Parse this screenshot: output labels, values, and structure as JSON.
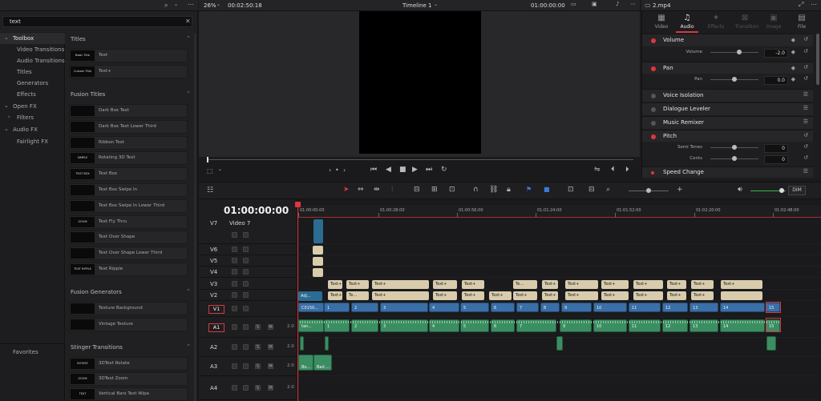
{
  "search": {
    "query": "text"
  },
  "tree": {
    "items": [
      {
        "label": "Toolbox",
        "arrow": "⌄"
      },
      {
        "label": "Video Transitions"
      },
      {
        "label": "Audio Transitions"
      },
      {
        "label": "Titles"
      },
      {
        "label": "Generators"
      },
      {
        "label": "Effects"
      },
      {
        "label": "Open FX",
        "arrow": "⌄"
      },
      {
        "label": "Filters",
        "arrow": "›"
      },
      {
        "label": "Audio FX",
        "arrow": "⌄"
      },
      {
        "label": "Fairlight FX"
      }
    ],
    "favorites": "Favorites"
  },
  "sections": {
    "titles": "Titles",
    "fusion_titles": "Fusion Titles",
    "fusion_generators": "Fusion Generators",
    "stinger": "Stinger Transitions"
  },
  "titles_items": [
    {
      "thumb": "Basic Title",
      "label": "Text"
    },
    {
      "thumb": "Custom Title",
      "label": "Text+"
    }
  ],
  "fusion_titles_items": [
    {
      "thumb": "",
      "label": "Dark Box Text"
    },
    {
      "thumb": "",
      "label": "Dark Box Text Lower Third"
    },
    {
      "thumb": "",
      "label": "Ribbon Text"
    },
    {
      "thumb": "SIMPLE",
      "label": "Rotating 3D Text"
    },
    {
      "thumb": "TEXT BOX",
      "label": "Text Box"
    },
    {
      "thumb": "",
      "label": "Text Box Swipe In"
    },
    {
      "thumb": "",
      "label": "Text Box Swipe In Lower Third"
    },
    {
      "thumb": "ZOOM",
      "label": "Text Fly Thru"
    },
    {
      "thumb": "",
      "label": "Text Over Shape"
    },
    {
      "thumb": "",
      "label": "Text Over Shape Lower Third"
    },
    {
      "thumb": "TEXT RIPPLE",
      "label": "Text Ripple"
    }
  ],
  "fusion_generators_items": [
    {
      "thumb": "",
      "label": "Texture Background"
    },
    {
      "thumb": "",
      "label": "Vintage Texture"
    }
  ],
  "stinger_items": [
    {
      "thumb": "ROTATE",
      "label": "3DText Rotate"
    },
    {
      "thumb": "ZOOM",
      "label": "3DText Zoom"
    },
    {
      "thumb": "TEXT",
      "label": "Vertical Bars Text Wipe"
    }
  ],
  "viewer": {
    "zoom": "26%",
    "timecode_left": "00:02:50:18",
    "timeline_name": "Timeline 1",
    "timecode_right": "01:00:00:00"
  },
  "inspector": {
    "clip_name": "2.mp4",
    "tabs": [
      "Video",
      "Audio",
      "Effects",
      "Transition",
      "Image",
      "File"
    ],
    "volume": {
      "label": "Volume",
      "param": "Volume",
      "value": "-2.0",
      "level": 0.6
    },
    "pan": {
      "label": "Pan",
      "param": "Pan",
      "value": "0.0",
      "level": 0.5
    },
    "voice_isolation": "Voice Isolation",
    "dialogue_leveler": "Dialogue Leveler",
    "music_remixer": "Music Remixer",
    "pitch": {
      "label": "Pitch",
      "semi_label": "Semi Tones",
      "semi_value": "0",
      "semi_level": 0.5,
      "cents_label": "Cents",
      "cents_value": "0",
      "cents_level": 0.5
    },
    "speed_change": "Speed Change"
  },
  "timeline": {
    "timecode": "01:00:00:00",
    "dim": "DIM",
    "ruler": [
      "01:00:00:00",
      "01:00:28:00",
      "01:00:56:00",
      "01:01:24:00",
      "01:01:52:00",
      "01:02:20:00",
      "01:02:48:00"
    ],
    "tracks": [
      {
        "id": "V7",
        "name": "Video 7"
      },
      {
        "id": "V6"
      },
      {
        "id": "V5"
      },
      {
        "id": "V4"
      },
      {
        "id": "V3"
      },
      {
        "id": "V2"
      },
      {
        "id": "V1",
        "boxed": true
      },
      {
        "id": "A1",
        "boxed": true,
        "level": "2.0"
      },
      {
        "id": "A2",
        "level": "2.0"
      },
      {
        "id": "A3",
        "level": "2.0"
      },
      {
        "id": "A4",
        "level": "2.0"
      }
    ],
    "v3_clips": [
      "Text+",
      "Text+",
      "Text+",
      "Text+",
      "Text+",
      "Te...",
      "Text+",
      "Text+",
      "Text+",
      "Text+",
      "Text+",
      "Text+",
      "Text+"
    ],
    "v2_clips": [
      "Adj...",
      "Text+",
      "Te...",
      "Text+",
      "Text+",
      "Text+",
      "Text+",
      "Text+",
      "Text+",
      "Text+",
      "Text+",
      "Text+",
      "Text+",
      "Text+"
    ],
    "v1_clips": [
      "C0150...",
      "1",
      "2",
      "3",
      "4",
      "5",
      "6",
      "7",
      "8",
      "9",
      "10",
      "11",
      "12",
      "13",
      "14",
      "15",
      "2...."
    ],
    "a1_clips": [
      "tan...",
      "1",
      "2",
      "3",
      "4",
      "5",
      "6",
      "7",
      "8",
      "9",
      "10",
      "11",
      "12",
      "13",
      "14",
      "15",
      "2...."
    ],
    "a3_clips": [
      "Bo...",
      "Bad ..."
    ]
  }
}
